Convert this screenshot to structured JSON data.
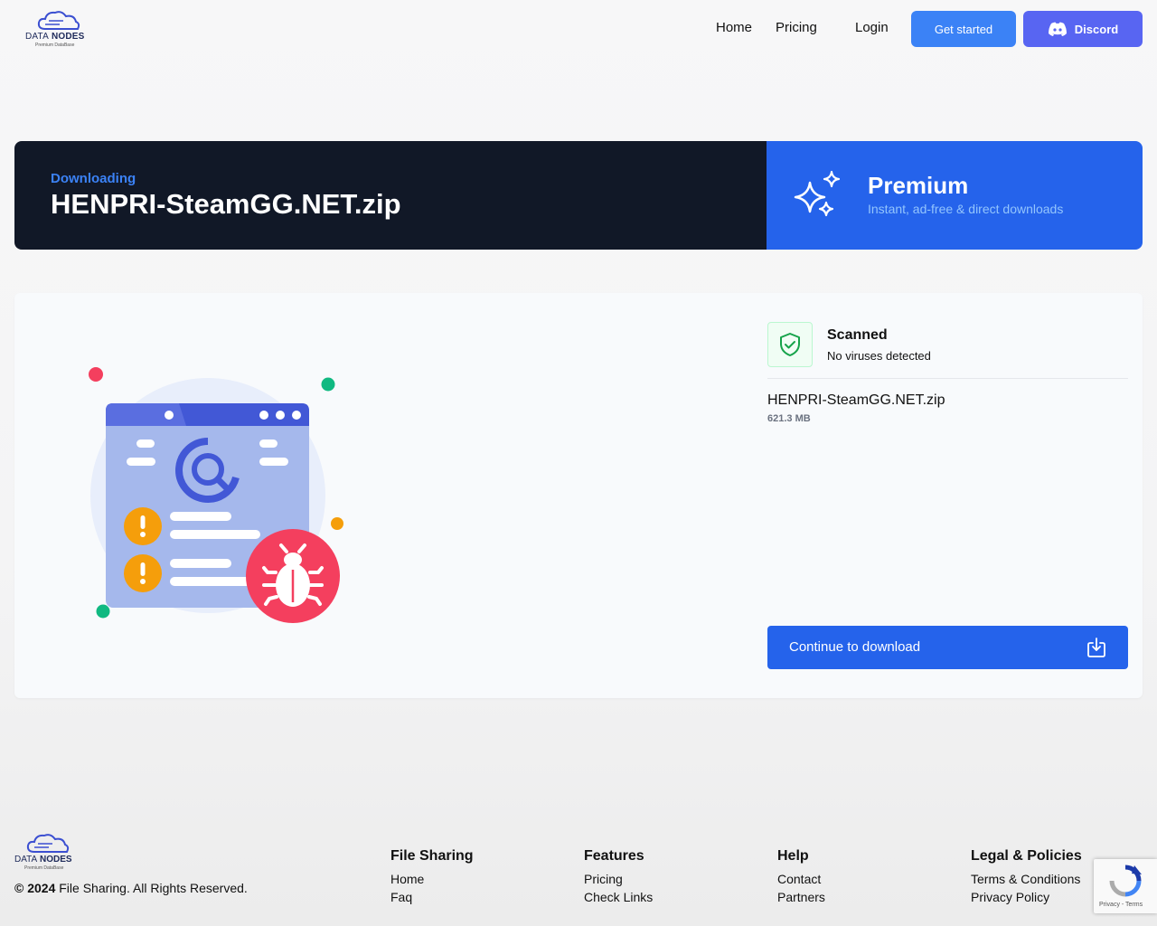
{
  "header": {
    "logo": {
      "brand_bold": "NODES",
      "brand_light": "DATA",
      "tagline": "Premium DataBase"
    },
    "nav": {
      "home": "Home",
      "pricing": "Pricing",
      "login": "Login"
    },
    "get_started": "Get started",
    "discord": "Discord"
  },
  "banner": {
    "label": "Downloading",
    "file_title": "HENPRI-SteamGG.NET.zip",
    "premium_title": "Premium",
    "premium_subtitle": "Instant, ad-free & direct downloads"
  },
  "scan": {
    "title": "Scanned",
    "subtitle": "No viruses detected"
  },
  "file": {
    "name": "HENPRI-SteamGG.NET.zip",
    "size": "621.3 MB"
  },
  "continue_label": "Continue to download",
  "footer": {
    "copyright_year": "© 2024",
    "copyright_text": " File Sharing. All Rights Reserved.",
    "columns": [
      {
        "heading": "File Sharing",
        "links": [
          "Home",
          "Faq"
        ]
      },
      {
        "heading": "Features",
        "links": [
          "Pricing",
          "Check Links"
        ]
      },
      {
        "heading": "Help",
        "links": [
          "Contact",
          "Partners"
        ]
      },
      {
        "heading": "Legal & Policies",
        "links": [
          "Terms & Conditions",
          "Privacy Policy"
        ]
      }
    ]
  },
  "recaptcha": {
    "text": "Privacy - Terms"
  },
  "colors": {
    "accent": "#2563eb",
    "dark": "#111827",
    "discord": "#5865f2",
    "bug": "#f43f5e"
  }
}
